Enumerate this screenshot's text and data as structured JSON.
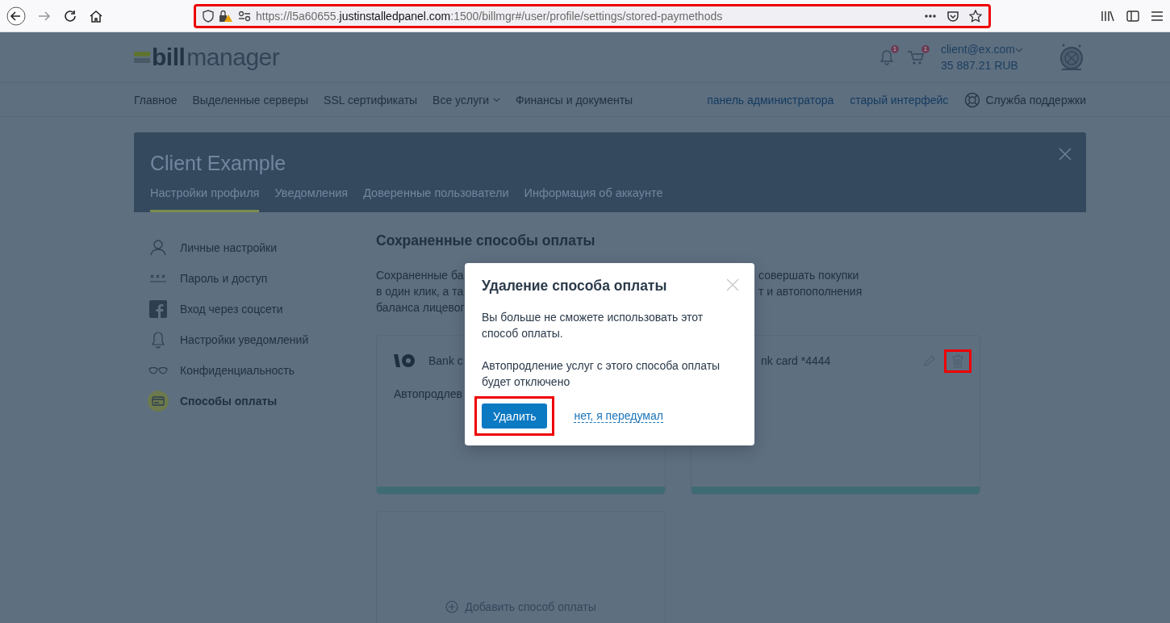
{
  "browser": {
    "url_prefix": "https://l5a60655.",
    "url_domain": "justinstalledpanel.com",
    "url_rest": ":1500/billmgr#/user/profile/settings/stored-paymethods",
    "highlighted": true
  },
  "header": {
    "logo_bold": "bill",
    "logo_light": "manager",
    "notifications_badge": "1",
    "cart_badge": "1",
    "user": "client@ex.com",
    "balance": "35 887.21 RUB"
  },
  "nav": {
    "items": [
      {
        "label": "Главное",
        "kind": "link"
      },
      {
        "label": "Выделенные серверы",
        "kind": "link"
      },
      {
        "label": "SSL сертификаты",
        "kind": "link"
      },
      {
        "label": "Все услуги",
        "kind": "dropdown"
      },
      {
        "label": "Финансы и документы",
        "kind": "link"
      }
    ],
    "links": [
      {
        "label": "панель администратора",
        "kind": "link"
      },
      {
        "label": "старый интерфейс",
        "kind": "link"
      },
      {
        "label": "Служба поддержки",
        "kind": "support"
      }
    ]
  },
  "profile": {
    "title": "Client Example",
    "tabs": [
      {
        "label": "Настройки профиля",
        "selected": true
      },
      {
        "label": "Уведомления",
        "selected": false
      },
      {
        "label": "Доверенные пользователи",
        "selected": false
      },
      {
        "label": "Информация об аккаунте",
        "selected": false
      }
    ]
  },
  "sidebar": {
    "items": [
      {
        "label": "Личные настройки",
        "selected": false
      },
      {
        "label": "Пароль и доступ",
        "selected": false
      },
      {
        "label": "Вход через соцсети",
        "selected": false
      },
      {
        "label": "Настройки уведомлений",
        "selected": false
      },
      {
        "label": "Конфиденциальность",
        "selected": false
      },
      {
        "label": "Способы оплаты",
        "selected": true
      }
    ]
  },
  "main": {
    "title": "Сохраненные способы оплаты",
    "intro_left": [
      "Сохраненные ба",
      "в один клик, а та",
      "баланса лицевог"
    ],
    "intro_right": [
      "совершать покупки",
      "т и автопополнения"
    ],
    "cards": [
      {
        "kind": "yoomoney",
        "name": "Bank c",
        "autorenew": "Автопродлев"
      },
      {
        "kind": "card",
        "name": "nk card *4444",
        "trash_highlighted": true
      }
    ],
    "add_label": "Добавить способ оплаты"
  },
  "modal": {
    "title": "Удаление способа оплаты",
    "paragraphs": [
      "Вы больше не сможете использовать этот способ оплаты.",
      "Автопродление услуг с этого способа оплаты будет отключено"
    ],
    "confirm": {
      "label": "Удалить",
      "highlighted": true
    },
    "cancel": "нет, я передумал"
  }
}
